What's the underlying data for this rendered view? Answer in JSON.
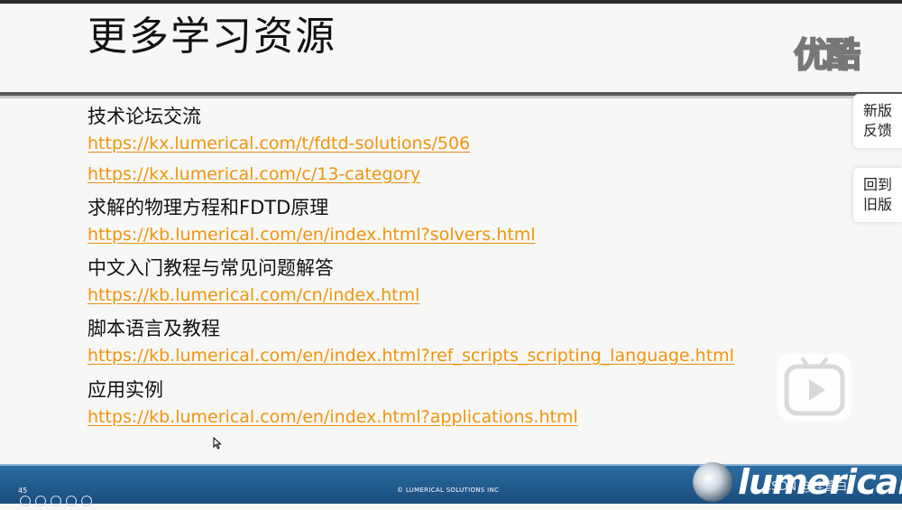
{
  "slide": {
    "title": "更多学习资源",
    "watermark": "优酷",
    "sections": [
      {
        "heading": "技术论坛交流",
        "links": [
          "https://kx.lumerical.com/t/fdtd-solutions/506",
          "https://kx.lumerical.com/c/13-category"
        ]
      },
      {
        "heading": "求解的物理方程和FDTD原理",
        "links": [
          "https://kb.lumerical.com/en/index.html?solvers.html"
        ]
      },
      {
        "heading": "中文入门教程与常见问题解答",
        "links": [
          "https://kb.lumerical.com/cn/index.html"
        ]
      },
      {
        "heading": "脚本语言及教程",
        "links": [
          "https://kb.lumerical.com/en/index.html?ref_scripts_scripting_language.html"
        ]
      },
      {
        "heading": "应用实例",
        "links": [
          "https://kb.lumerical.com/en/index.html?applications.html"
        ]
      }
    ]
  },
  "sidebar": {
    "feedback": [
      "新版",
      "反馈"
    ],
    "old_version": [
      "回到",
      "旧版"
    ]
  },
  "footer": {
    "slide_number": "45",
    "copyright": "© LUMERICAL SOLUTIONS INC",
    "logo": "lumerical",
    "csdn_watermark": "CSDN @梓萱白"
  },
  "colors": {
    "link": "#f0950a",
    "footer": "#1f5a8c",
    "rule": "#5a5a5a"
  },
  "icons": [
    "play-icon",
    "cursor-icon",
    "lumerical-logo-icon"
  ]
}
